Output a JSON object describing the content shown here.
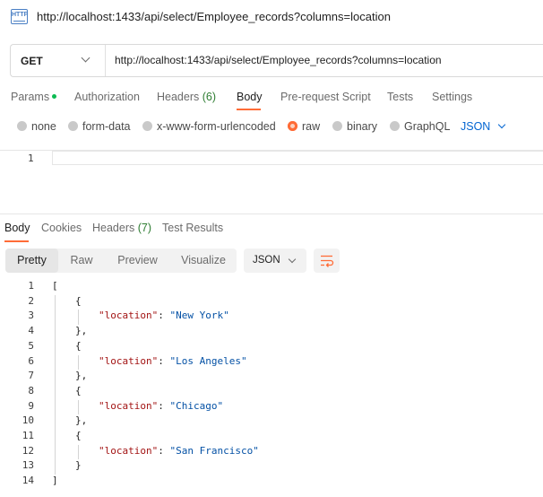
{
  "window": {
    "icon": "http-icon",
    "icon_text": "HTTP",
    "title": "http://localhost:1433/api/select/Employee_records?columns=location"
  },
  "request": {
    "method": "GET",
    "url": "http://localhost:1433/api/select/Employee_records?columns=location",
    "tabs": [
      {
        "label": "Params",
        "has_dot": true
      },
      {
        "label": "Authorization"
      },
      {
        "label": "Headers",
        "count": "(6)"
      },
      {
        "label": "Body",
        "active": true
      },
      {
        "label": "Pre-request Script"
      },
      {
        "label": "Tests"
      },
      {
        "label": "Settings"
      }
    ],
    "body_types": [
      "none",
      "form-data",
      "x-www-form-urlencoded",
      "raw",
      "binary",
      "GraphQL"
    ],
    "selected_body_type": "raw",
    "body_format": "JSON",
    "editor_line_number": "1"
  },
  "response": {
    "tabs": [
      {
        "label": "Body",
        "active": true
      },
      {
        "label": "Cookies"
      },
      {
        "label": "Headers",
        "count": "(7)"
      },
      {
        "label": "Test Results"
      }
    ],
    "views": [
      "Pretty",
      "Raw",
      "Preview",
      "Visualize"
    ],
    "active_view": "Pretty",
    "format": "JSON",
    "lines": [
      {
        "n": "1",
        "parts": [
          {
            "t": "[",
            "c": "p"
          }
        ]
      },
      {
        "n": "2",
        "parts": [
          {
            "t": "{",
            "c": "p"
          }
        ]
      },
      {
        "n": "3",
        "parts": [
          {
            "t": "\"location\"",
            "c": "k"
          },
          {
            "t": ": ",
            "c": "p"
          },
          {
            "t": "\"New York\"",
            "c": "s"
          }
        ]
      },
      {
        "n": "4",
        "parts": [
          {
            "t": "},",
            "c": "p"
          }
        ]
      },
      {
        "n": "5",
        "parts": [
          {
            "t": "{",
            "c": "p"
          }
        ]
      },
      {
        "n": "6",
        "parts": [
          {
            "t": "\"location\"",
            "c": "k"
          },
          {
            "t": ": ",
            "c": "p"
          },
          {
            "t": "\"Los Angeles\"",
            "c": "s"
          }
        ]
      },
      {
        "n": "7",
        "parts": [
          {
            "t": "},",
            "c": "p"
          }
        ]
      },
      {
        "n": "8",
        "parts": [
          {
            "t": "{",
            "c": "p"
          }
        ]
      },
      {
        "n": "9",
        "parts": [
          {
            "t": "\"location\"",
            "c": "k"
          },
          {
            "t": ": ",
            "c": "p"
          },
          {
            "t": "\"Chicago\"",
            "c": "s"
          }
        ]
      },
      {
        "n": "10",
        "parts": [
          {
            "t": "},",
            "c": "p"
          }
        ]
      },
      {
        "n": "11",
        "parts": [
          {
            "t": "{",
            "c": "p"
          }
        ]
      },
      {
        "n": "12",
        "parts": [
          {
            "t": "\"location\"",
            "c": "k"
          },
          {
            "t": ": ",
            "c": "p"
          },
          {
            "t": "\"San Francisco\"",
            "c": "s"
          }
        ]
      },
      {
        "n": "13",
        "parts": [
          {
            "t": "}",
            "c": "p"
          }
        ]
      },
      {
        "n": "14",
        "parts": [
          {
            "t": "]",
            "c": "p"
          }
        ]
      }
    ]
  },
  "colors": {
    "accent": "#ff6c37",
    "link_blue": "#0265d2",
    "json_key": "#a31515",
    "json_string": "#0451a5",
    "count_green": "#2e7d32",
    "dot_green": "#0cbb52"
  }
}
